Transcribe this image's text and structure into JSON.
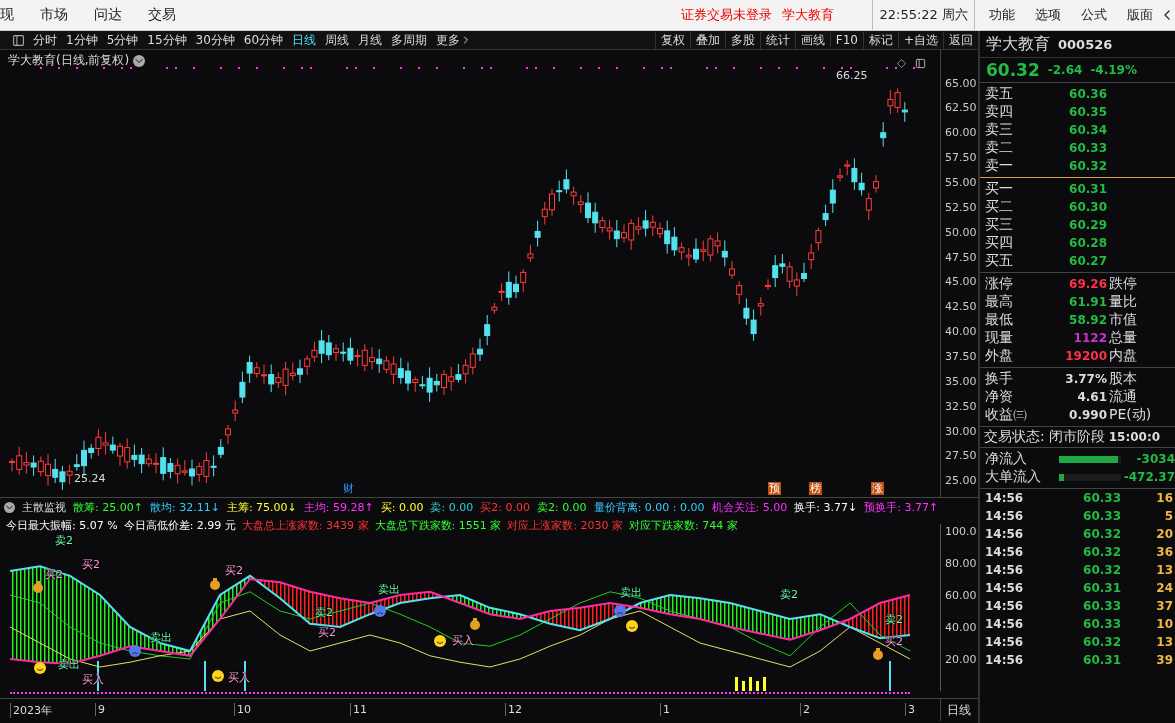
{
  "menu_bar": {
    "items": [
      "现",
      "市场",
      "问达",
      "交易"
    ],
    "notice": "证券交易未登录",
    "stock": "学大教育",
    "clock": "22:55:22 周六",
    "right_items": [
      "功能",
      "选项",
      "公式",
      "版面"
    ]
  },
  "periods": [
    {
      "label": "分时",
      "selected": false
    },
    {
      "label": "1分钟",
      "selected": false
    },
    {
      "label": "5分钟",
      "selected": false
    },
    {
      "label": "15分钟",
      "selected": false
    },
    {
      "label": "30分钟",
      "selected": false
    },
    {
      "label": "60分钟",
      "selected": false
    },
    {
      "label": "日线",
      "selected": true
    },
    {
      "label": "周线",
      "selected": false
    },
    {
      "label": "月线",
      "selected": false
    },
    {
      "label": "多周期",
      "selected": false
    },
    {
      "label": "更多",
      "selected": false
    }
  ],
  "tools": [
    "复权",
    "叠加",
    "多股",
    "统计",
    "画线",
    "F10",
    "标记",
    "+自选",
    "返回"
  ],
  "chart": {
    "title": "学大教育(日线,前复权)",
    "high_label": "66.25",
    "low_label": "25.24",
    "y_labels": [
      "65.00",
      "62.50",
      "60.00",
      "57.50",
      "55.00",
      "52.50",
      "50.00",
      "47.50",
      "45.00",
      "42.50",
      "40.00",
      "37.50",
      "35.00",
      "32.50",
      "30.00",
      "27.50",
      "25.00"
    ],
    "badges": [
      {
        "label": "财",
        "kind": "plain"
      },
      {
        "label": "预",
        "kind": "box"
      },
      {
        "label": "榜",
        "kind": "box"
      },
      {
        "label": "涨",
        "kind": "box"
      }
    ]
  },
  "indicator": {
    "name": "主散监视",
    "values": [
      {
        "label": "散筹:",
        "value": "25.00↑",
        "color": "#33ff33"
      },
      {
        "label": "散均:",
        "value": "32.11↓",
        "color": "#33ccff"
      },
      {
        "label": "主筹:",
        "value": "75.00↓",
        "color": "#ffff33"
      },
      {
        "label": "主均:",
        "value": "59.28↑",
        "color": "#ff33ff"
      },
      {
        "label": "买:",
        "value": "0.00",
        "color": "#ffff33"
      },
      {
        "label": "卖:",
        "value": "0.00",
        "color": "#33cccc"
      },
      {
        "label": "买2:",
        "value": "0.00",
        "color": "#ff3333"
      },
      {
        "label": "卖2:",
        "value": "0.00",
        "color": "#33ff33"
      },
      {
        "label": "量价背离:",
        "value": "0.00 : 0.00",
        "color": "#33ccff"
      },
      {
        "label": "机会关注:",
        "value": "5.00",
        "color": "#ff33ff"
      },
      {
        "label": "换手:",
        "value": "3.77↓",
        "color": "#ffffff"
      },
      {
        "label": "预换手:",
        "value": "3.77↑",
        "color": "#ff33ff"
      }
    ],
    "stats": [
      {
        "text": "今日最大振幅: 5.07 %",
        "color": "#ffffff"
      },
      {
        "text": "今日高低价差: 2.99 元",
        "color": "#ffffff"
      },
      {
        "text": "大盘总上涨家数: 3439 家",
        "color": "#ff3333"
      },
      {
        "text": "大盘总下跌家数: 1551 家",
        "color": "#33ff33"
      },
      {
        "text": "对应上涨家数: 2030 家",
        "color": "#ff3333"
      },
      {
        "text": "对应下跌家数: 744 家",
        "color": "#33ff33"
      }
    ],
    "chart_data": {
      "type": "line",
      "ylim": [
        0,
        104.4
      ],
      "yticks": [
        {
          "value": 100,
          "label": "100.0"
        },
        {
          "value": 80,
          "label": "80.00"
        },
        {
          "value": 60,
          "label": "60.00"
        },
        {
          "value": 40,
          "label": "40.00"
        },
        {
          "value": 20,
          "label": "20.00"
        }
      ],
      "series": [
        {
          "color": "#22cc22",
          "values": [
            60,
            55,
            40,
            30,
            25,
            22,
            20,
            55,
            62,
            50,
            45,
            50,
            55,
            48,
            40,
            30,
            28,
            35,
            45,
            55,
            62,
            58,
            50,
            45,
            40,
            30,
            22,
            40,
            55,
            35,
            25
          ]
        },
        {
          "color": "#e0e060",
          "values": [
            40,
            30,
            20,
            15,
            18,
            22,
            25,
            45,
            50,
            35,
            25,
            30,
            35,
            30,
            22,
            18,
            15,
            20,
            28,
            35,
            45,
            50,
            40,
            30,
            25,
            20,
            15,
            25,
            40,
            30,
            20
          ]
        },
        {
          "color": "#54e3ee",
          "values": [
            75,
            78,
            72,
            60,
            40,
            30,
            25,
            60,
            72,
            58,
            42,
            40,
            48,
            55,
            58,
            60,
            52,
            48,
            42,
            38,
            45,
            55,
            60,
            58,
            55,
            50,
            45,
            48,
            40,
            33,
            35
          ]
        },
        {
          "color": "#ff2aa0",
          "values": [
            20,
            18,
            17,
            22,
            28,
            25,
            22,
            45,
            70,
            68,
            62,
            58,
            55,
            60,
            62,
            55,
            48,
            45,
            50,
            52,
            55,
            52,
            48,
            45,
            40,
            36,
            32,
            38,
            45,
            55,
            60
          ]
        }
      ]
    },
    "signals": [
      {
        "label": "卖2",
        "kind": "sell"
      },
      {
        "label": "买2",
        "kind": "buy"
      },
      {
        "label": "买2",
        "kind": "buy"
      },
      {
        "label": "买2",
        "kind": "buy"
      },
      {
        "label": "卖出",
        "kind": "sell"
      },
      {
        "label": "卖出",
        "kind": "sell"
      },
      {
        "label": "买入",
        "kind": "buy"
      },
      {
        "label": "买入",
        "kind": "buy"
      },
      {
        "label": "卖2",
        "kind": "sell"
      },
      {
        "label": "买2",
        "kind": "buy"
      },
      {
        "label": "卖出",
        "kind": "sell"
      },
      {
        "label": "买入",
        "kind": "buy"
      },
      {
        "label": "卖出",
        "kind": "sell"
      },
      {
        "label": "卖2",
        "kind": "sell"
      },
      {
        "label": "卖2",
        "kind": "sell"
      },
      {
        "label": "买2",
        "kind": "buy"
      }
    ]
  },
  "x_axis": {
    "labels": [
      "2023年",
      "9",
      "10",
      "11",
      "12",
      "1",
      "2",
      "3"
    ],
    "period": "日线"
  },
  "quote": {
    "name": "学大教育",
    "code": "000526",
    "price": "60.32",
    "change": "-2.64",
    "percent": "-4.19%",
    "asks": [
      {
        "label": "卖五",
        "price": "60.36"
      },
      {
        "label": "卖四",
        "price": "60.35"
      },
      {
        "label": "卖三",
        "price": "60.34"
      },
      {
        "label": "卖二",
        "price": "60.33"
      },
      {
        "label": "卖一",
        "price": "60.32"
      }
    ],
    "bids": [
      {
        "label": "买一",
        "price": "60.31"
      },
      {
        "label": "买二",
        "price": "60.30"
      },
      {
        "label": "买三",
        "price": "60.29"
      },
      {
        "label": "买四",
        "price": "60.28"
      },
      {
        "label": "买五",
        "price": "60.27"
      }
    ],
    "stats": [
      {
        "label": "涨停",
        "value": "69.26",
        "color": "#ff3344",
        "label2": "跌停"
      },
      {
        "label": "最高",
        "value": "61.91",
        "color": "#22bb44",
        "label2": "量比"
      },
      {
        "label": "最低",
        "value": "58.92",
        "color": "#22bb44",
        "label2": "市值"
      },
      {
        "label": "现量",
        "value": "1122",
        "color": "#cc33cc",
        "label2": "总量"
      },
      {
        "label": "外盘",
        "value": "19200",
        "color": "#ff3344",
        "label2": "内盘"
      }
    ],
    "fundamentals": [
      {
        "label": "换手",
        "value": "3.77%",
        "label2": "股本"
      },
      {
        "label": "净资",
        "value": "4.61",
        "label2": "流通"
      },
      {
        "label": "收益㈢",
        "value": "0.990",
        "label2": "PE(动)"
      }
    ],
    "status": {
      "label": "交易状态:",
      "value": "闭市阶段",
      "time": "15:00:0"
    },
    "flows": [
      {
        "label": "净流入",
        "value": "-3034",
        "level": 0.95
      },
      {
        "label": "大单流入",
        "value": "-472.37",
        "level": 0.08
      }
    ],
    "ticks": [
      {
        "time": "14:56",
        "price": "60.33",
        "volume": "16"
      },
      {
        "time": "14:56",
        "price": "60.33",
        "volume": "5"
      },
      {
        "time": "14:56",
        "price": "60.32",
        "volume": "20"
      },
      {
        "time": "14:56",
        "price": "60.32",
        "volume": "36"
      },
      {
        "time": "14:56",
        "price": "60.32",
        "volume": "13"
      },
      {
        "time": "14:56",
        "price": "60.31",
        "volume": "24"
      },
      {
        "time": "14:56",
        "price": "60.33",
        "volume": "37"
      },
      {
        "time": "14:56",
        "price": "60.33",
        "volume": "10"
      },
      {
        "time": "14:56",
        "price": "60.32",
        "volume": "13"
      },
      {
        "time": "14:56",
        "price": "60.31",
        "volume": "39"
      }
    ]
  }
}
